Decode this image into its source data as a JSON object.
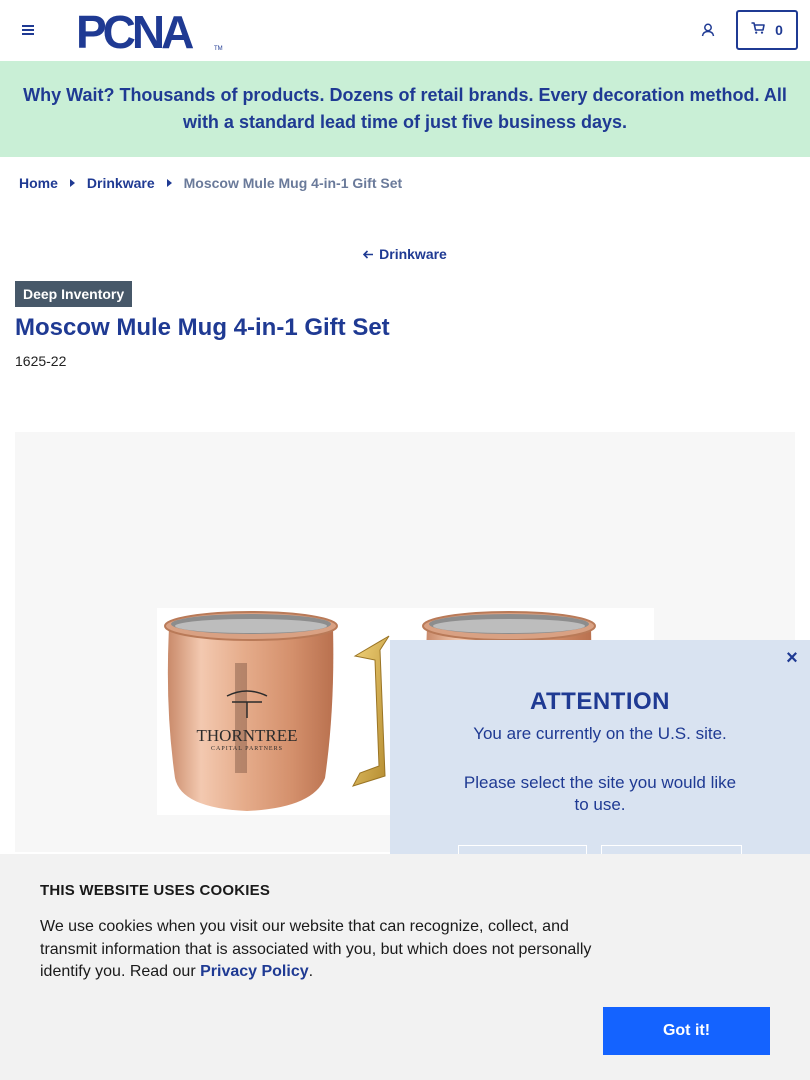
{
  "header": {
    "logo_text": "PCNA",
    "logo_tm": "TM",
    "cart_count": "0"
  },
  "promo": {
    "text": "Why Wait? Thousands of products. Dozens of retail brands. Every decoration method. All with a standard lead time of just five business days."
  },
  "breadcrumb": {
    "items": [
      "Home",
      "Drinkware"
    ],
    "current": "Moscow Mule Mug 4-in-1 Gift Set"
  },
  "back_link": "Drinkware",
  "product": {
    "badge": "Deep Inventory",
    "title": "Moscow Mule Mug 4-in-1 Gift Set",
    "sku": "1625-22",
    "imprint_brand": "THORNTREE",
    "imprint_sub": "CAPITAL PARTNERS"
  },
  "attention": {
    "close": "×",
    "title": "ATTENTION",
    "line1": "You are currently on the U.S. site.",
    "line2": "Please select the site you would like to use."
  },
  "cookie": {
    "title": "THIS WEBSITE USES COOKIES",
    "text": "We use cookies when you visit our website that can recognize, collect, and transmit information that is associated with you, but which does not personally identify you. Read our ",
    "link": "Privacy Policy",
    "text_end": ".",
    "button": "Got it!"
  },
  "colors": {
    "brand_blue": "#1f3a93",
    "promo_bg": "#c9efd6",
    "badge_bg": "#475869",
    "attention_bg": "#d9e3f1",
    "cookie_button": "#1463ff"
  },
  "icons": [
    "hamburger-menu-icon",
    "account-icon",
    "cart-icon",
    "caret-right-icon",
    "arrow-left-icon",
    "close-icon"
  ]
}
